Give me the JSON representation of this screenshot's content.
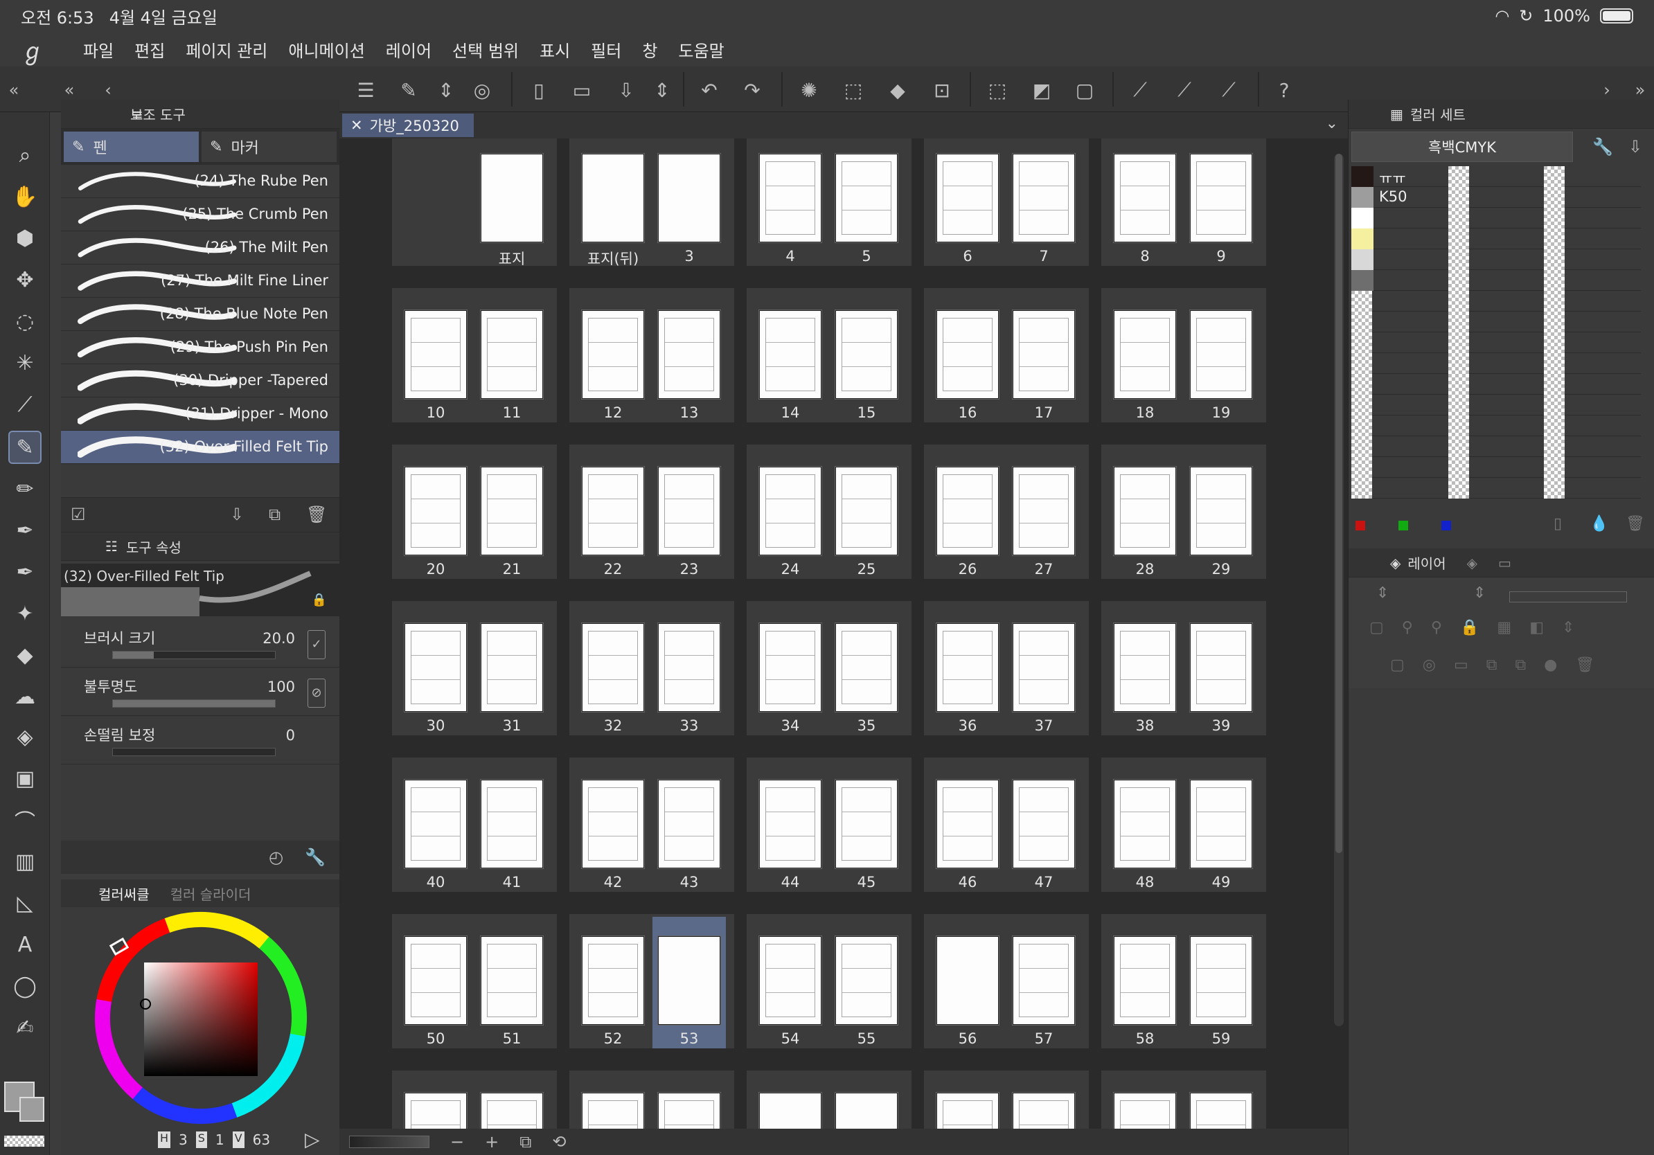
{
  "status": {
    "time": "오전 6:53",
    "date": "4월 4일 금요일",
    "battery": "100%"
  },
  "menu": [
    "파일",
    "편집",
    "페이지 관리",
    "애니메이션",
    "레이어",
    "선택 범위",
    "표시",
    "필터",
    "창",
    "도움말"
  ],
  "subtool": {
    "title": "보조 도구",
    "tabs": [
      "펜",
      "마커"
    ],
    "brushes": [
      "(24) The Rube Pen",
      "(25) The Crumb Pen",
      "(26) The Milt Pen",
      "(27) The Milt Fine Liner",
      "(28) The Blue Note Pen",
      "(29) The Push Pin Pen",
      "(30) Dripper -Tapered",
      "(31) Dripper - Mono",
      "(32) Over-Filled Felt Tip"
    ],
    "active_index": 8
  },
  "tool_property": {
    "title": "도구 속성",
    "brush_name": "(32) Over-Filled Felt Tip",
    "props": [
      {
        "label": "브러시 크기",
        "value": "20.0",
        "fill": 0.25
      },
      {
        "label": "불투명도",
        "value": "100",
        "fill": 1.0
      },
      {
        "label": "손떨림 보정",
        "value": "0",
        "fill": 0.0
      }
    ]
  },
  "color": {
    "tabs": [
      "컬러써클",
      "컬러 슬라이더"
    ],
    "h_label": "H",
    "h": "3",
    "s_label": "S",
    "s": "1",
    "v_label": "V",
    "v": "63"
  },
  "document": {
    "tab": "가방_250320",
    "spreads": [
      {
        "left": "",
        "right": "표지",
        "right_blank": true,
        "empty_left": true
      },
      {
        "left": "표지(뒤)",
        "right": "3",
        "left_blank": true,
        "right_blank": true
      },
      {
        "left": "4",
        "right": "5"
      },
      {
        "left": "6",
        "right": "7"
      },
      {
        "left": "8",
        "right": "9"
      },
      {
        "left": "10",
        "right": "11"
      },
      {
        "left": "12",
        "right": "13"
      },
      {
        "left": "14",
        "right": "15"
      },
      {
        "left": "16",
        "right": "17"
      },
      {
        "left": "18",
        "right": "19"
      },
      {
        "left": "20",
        "right": "21"
      },
      {
        "left": "22",
        "right": "23"
      },
      {
        "left": "24",
        "right": "25"
      },
      {
        "left": "26",
        "right": "27"
      },
      {
        "left": "28",
        "right": "29"
      },
      {
        "left": "30",
        "right": "31"
      },
      {
        "left": "32",
        "right": "33"
      },
      {
        "left": "34",
        "right": "35"
      },
      {
        "left": "36",
        "right": "37"
      },
      {
        "left": "38",
        "right": "39"
      },
      {
        "left": "40",
        "right": "41"
      },
      {
        "left": "42",
        "right": "43"
      },
      {
        "left": "44",
        "right": "45"
      },
      {
        "left": "46",
        "right": "47"
      },
      {
        "left": "48",
        "right": "49"
      },
      {
        "left": "50",
        "right": "51"
      },
      {
        "left": "52",
        "right": "53",
        "right_blank": true,
        "selected": "right"
      },
      {
        "left": "54",
        "right": "55"
      },
      {
        "left": "56",
        "right": "57",
        "left_blank": true
      },
      {
        "left": "58",
        "right": "59"
      },
      {
        "left": "",
        "right": ""
      },
      {
        "left": "",
        "right": ""
      },
      {
        "left": "",
        "right": "",
        "left_blank": true,
        "right_blank": true
      },
      {
        "left": "",
        "right": ""
      },
      {
        "left": "",
        "right": ""
      }
    ]
  },
  "color_set": {
    "title": "컬러 세트",
    "set_name": "흑백CMYK",
    "swatches": [
      {
        "color": "#231816",
        "name": "ㅠㅠ"
      },
      {
        "color": "#9d9d9d",
        "name": "K50"
      },
      {
        "color": "#ffffff",
        "name": ""
      },
      {
        "color": "#f5f0a0",
        "name": ""
      },
      {
        "color": "#d8d8d8",
        "name": ""
      },
      {
        "color": "#6e6e6e",
        "name": ""
      }
    ],
    "rgb_dots": [
      "#cc1111",
      "#11aa11",
      "#1122cc"
    ]
  },
  "layer": {
    "title": "레이어"
  }
}
